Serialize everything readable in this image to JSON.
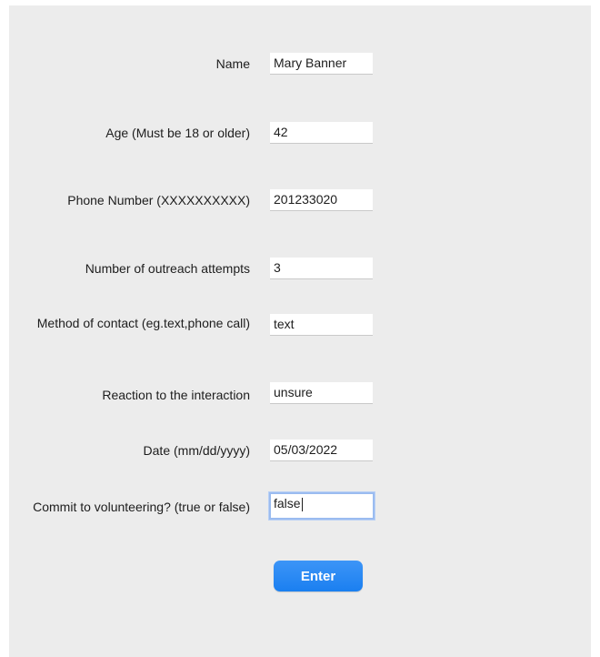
{
  "form": {
    "fields": [
      {
        "label": "Name",
        "value": "Mary Banner"
      },
      {
        "label": "Age (Must be 18 or older)",
        "value": "42"
      },
      {
        "label": "Phone Number (XXXXXXXXXX)",
        "value": "201233020"
      },
      {
        "label": "Number of outreach attempts",
        "value": "3"
      },
      {
        "label": "Method of contact (eg.text,phone call)",
        "value": "text"
      },
      {
        "label": "Reaction to the interaction",
        "value": "unsure"
      },
      {
        "label": "Date (mm/dd/yyyy)",
        "value": "05/03/2022"
      },
      {
        "label": "Commit to volunteering? (true or false)",
        "value": "false"
      }
    ],
    "submit_label": "Enter"
  },
  "colors": {
    "window_background": "#ececec",
    "accent": "#1a7ff0",
    "focus_ring": "#9bbcf0"
  }
}
